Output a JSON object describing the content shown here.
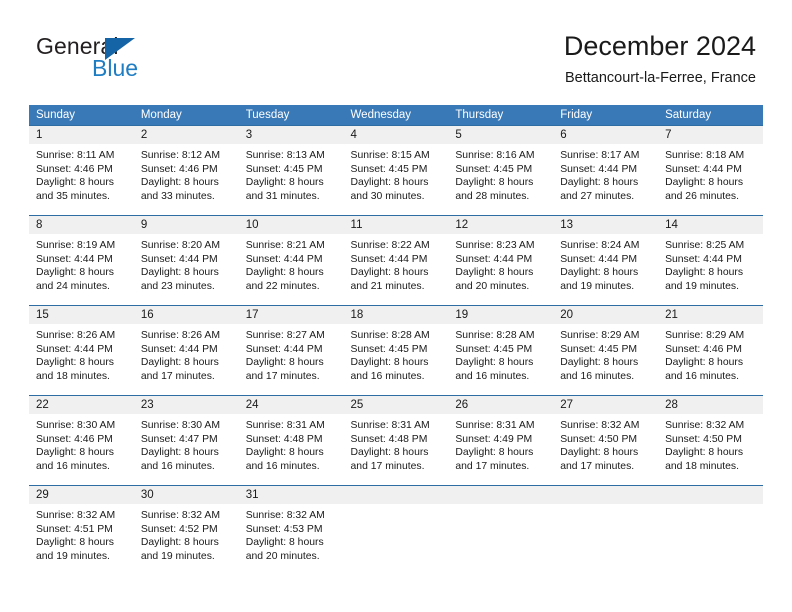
{
  "brand": {
    "name_part1": "General",
    "name_part2": "Blue",
    "flag_icon": "brand-flag-icon",
    "accent_color": "#1f7dc4",
    "flag_color": "#1565a6"
  },
  "header": {
    "title": "December 2024",
    "subtitle": "Bettancourt-la-Ferree, France"
  },
  "theme": {
    "header_row_bg": "#3a79b8",
    "header_row_text": "#ffffff",
    "week_divider": "#2e6ca4",
    "day_number_bg": "#f0f0f0",
    "page_bg": "#ffffff",
    "body_text": "#1a1a1a"
  },
  "weekdays": [
    "Sunday",
    "Monday",
    "Tuesday",
    "Wednesday",
    "Thursday",
    "Friday",
    "Saturday"
  ],
  "weeks": [
    [
      {
        "day": "1",
        "sunrise": "Sunrise: 8:11 AM",
        "sunset": "Sunset: 4:46 PM",
        "daylight_line1": "Daylight: 8 hours",
        "daylight_line2": "and 35 minutes."
      },
      {
        "day": "2",
        "sunrise": "Sunrise: 8:12 AM",
        "sunset": "Sunset: 4:46 PM",
        "daylight_line1": "Daylight: 8 hours",
        "daylight_line2": "and 33 minutes."
      },
      {
        "day": "3",
        "sunrise": "Sunrise: 8:13 AM",
        "sunset": "Sunset: 4:45 PM",
        "daylight_line1": "Daylight: 8 hours",
        "daylight_line2": "and 31 minutes."
      },
      {
        "day": "4",
        "sunrise": "Sunrise: 8:15 AM",
        "sunset": "Sunset: 4:45 PM",
        "daylight_line1": "Daylight: 8 hours",
        "daylight_line2": "and 30 minutes."
      },
      {
        "day": "5",
        "sunrise": "Sunrise: 8:16 AM",
        "sunset": "Sunset: 4:45 PM",
        "daylight_line1": "Daylight: 8 hours",
        "daylight_line2": "and 28 minutes."
      },
      {
        "day": "6",
        "sunrise": "Sunrise: 8:17 AM",
        "sunset": "Sunset: 4:44 PM",
        "daylight_line1": "Daylight: 8 hours",
        "daylight_line2": "and 27 minutes."
      },
      {
        "day": "7",
        "sunrise": "Sunrise: 8:18 AM",
        "sunset": "Sunset: 4:44 PM",
        "daylight_line1": "Daylight: 8 hours",
        "daylight_line2": "and 26 minutes."
      }
    ],
    [
      {
        "day": "8",
        "sunrise": "Sunrise: 8:19 AM",
        "sunset": "Sunset: 4:44 PM",
        "daylight_line1": "Daylight: 8 hours",
        "daylight_line2": "and 24 minutes."
      },
      {
        "day": "9",
        "sunrise": "Sunrise: 8:20 AM",
        "sunset": "Sunset: 4:44 PM",
        "daylight_line1": "Daylight: 8 hours",
        "daylight_line2": "and 23 minutes."
      },
      {
        "day": "10",
        "sunrise": "Sunrise: 8:21 AM",
        "sunset": "Sunset: 4:44 PM",
        "daylight_line1": "Daylight: 8 hours",
        "daylight_line2": "and 22 minutes."
      },
      {
        "day": "11",
        "sunrise": "Sunrise: 8:22 AM",
        "sunset": "Sunset: 4:44 PM",
        "daylight_line1": "Daylight: 8 hours",
        "daylight_line2": "and 21 minutes."
      },
      {
        "day": "12",
        "sunrise": "Sunrise: 8:23 AM",
        "sunset": "Sunset: 4:44 PM",
        "daylight_line1": "Daylight: 8 hours",
        "daylight_line2": "and 20 minutes."
      },
      {
        "day": "13",
        "sunrise": "Sunrise: 8:24 AM",
        "sunset": "Sunset: 4:44 PM",
        "daylight_line1": "Daylight: 8 hours",
        "daylight_line2": "and 19 minutes."
      },
      {
        "day": "14",
        "sunrise": "Sunrise: 8:25 AM",
        "sunset": "Sunset: 4:44 PM",
        "daylight_line1": "Daylight: 8 hours",
        "daylight_line2": "and 19 minutes."
      }
    ],
    [
      {
        "day": "15",
        "sunrise": "Sunrise: 8:26 AM",
        "sunset": "Sunset: 4:44 PM",
        "daylight_line1": "Daylight: 8 hours",
        "daylight_line2": "and 18 minutes."
      },
      {
        "day": "16",
        "sunrise": "Sunrise: 8:26 AM",
        "sunset": "Sunset: 4:44 PM",
        "daylight_line1": "Daylight: 8 hours",
        "daylight_line2": "and 17 minutes."
      },
      {
        "day": "17",
        "sunrise": "Sunrise: 8:27 AM",
        "sunset": "Sunset: 4:44 PM",
        "daylight_line1": "Daylight: 8 hours",
        "daylight_line2": "and 17 minutes."
      },
      {
        "day": "18",
        "sunrise": "Sunrise: 8:28 AM",
        "sunset": "Sunset: 4:45 PM",
        "daylight_line1": "Daylight: 8 hours",
        "daylight_line2": "and 16 minutes."
      },
      {
        "day": "19",
        "sunrise": "Sunrise: 8:28 AM",
        "sunset": "Sunset: 4:45 PM",
        "daylight_line1": "Daylight: 8 hours",
        "daylight_line2": "and 16 minutes."
      },
      {
        "day": "20",
        "sunrise": "Sunrise: 8:29 AM",
        "sunset": "Sunset: 4:45 PM",
        "daylight_line1": "Daylight: 8 hours",
        "daylight_line2": "and 16 minutes."
      },
      {
        "day": "21",
        "sunrise": "Sunrise: 8:29 AM",
        "sunset": "Sunset: 4:46 PM",
        "daylight_line1": "Daylight: 8 hours",
        "daylight_line2": "and 16 minutes."
      }
    ],
    [
      {
        "day": "22",
        "sunrise": "Sunrise: 8:30 AM",
        "sunset": "Sunset: 4:46 PM",
        "daylight_line1": "Daylight: 8 hours",
        "daylight_line2": "and 16 minutes."
      },
      {
        "day": "23",
        "sunrise": "Sunrise: 8:30 AM",
        "sunset": "Sunset: 4:47 PM",
        "daylight_line1": "Daylight: 8 hours",
        "daylight_line2": "and 16 minutes."
      },
      {
        "day": "24",
        "sunrise": "Sunrise: 8:31 AM",
        "sunset": "Sunset: 4:48 PM",
        "daylight_line1": "Daylight: 8 hours",
        "daylight_line2": "and 16 minutes."
      },
      {
        "day": "25",
        "sunrise": "Sunrise: 8:31 AM",
        "sunset": "Sunset: 4:48 PM",
        "daylight_line1": "Daylight: 8 hours",
        "daylight_line2": "and 17 minutes."
      },
      {
        "day": "26",
        "sunrise": "Sunrise: 8:31 AM",
        "sunset": "Sunset: 4:49 PM",
        "daylight_line1": "Daylight: 8 hours",
        "daylight_line2": "and 17 minutes."
      },
      {
        "day": "27",
        "sunrise": "Sunrise: 8:32 AM",
        "sunset": "Sunset: 4:50 PM",
        "daylight_line1": "Daylight: 8 hours",
        "daylight_line2": "and 17 minutes."
      },
      {
        "day": "28",
        "sunrise": "Sunrise: 8:32 AM",
        "sunset": "Sunset: 4:50 PM",
        "daylight_line1": "Daylight: 8 hours",
        "daylight_line2": "and 18 minutes."
      }
    ],
    [
      {
        "day": "29",
        "sunrise": "Sunrise: 8:32 AM",
        "sunset": "Sunset: 4:51 PM",
        "daylight_line1": "Daylight: 8 hours",
        "daylight_line2": "and 19 minutes."
      },
      {
        "day": "30",
        "sunrise": "Sunrise: 8:32 AM",
        "sunset": "Sunset: 4:52 PM",
        "daylight_line1": "Daylight: 8 hours",
        "daylight_line2": "and 19 minutes."
      },
      {
        "day": "31",
        "sunrise": "Sunrise: 8:32 AM",
        "sunset": "Sunset: 4:53 PM",
        "daylight_line1": "Daylight: 8 hours",
        "daylight_line2": "and 20 minutes."
      },
      {
        "day": "",
        "sunrise": "",
        "sunset": "",
        "daylight_line1": "",
        "daylight_line2": ""
      },
      {
        "day": "",
        "sunrise": "",
        "sunset": "",
        "daylight_line1": "",
        "daylight_line2": ""
      },
      {
        "day": "",
        "sunrise": "",
        "sunset": "",
        "daylight_line1": "",
        "daylight_line2": ""
      },
      {
        "day": "",
        "sunrise": "",
        "sunset": "",
        "daylight_line1": "",
        "daylight_line2": ""
      }
    ]
  ]
}
